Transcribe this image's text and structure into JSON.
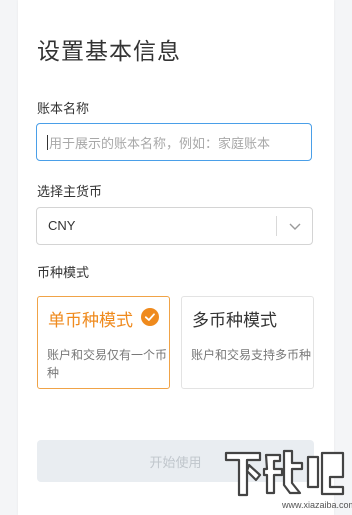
{
  "page": {
    "title": "设置基本信息"
  },
  "account_name": {
    "label": "账本名称",
    "placeholder": "用于展示的账本名称，例如：家庭账本"
  },
  "currency": {
    "label": "选择主货币",
    "selected": "CNY"
  },
  "currency_mode": {
    "label": "币种模式",
    "options": [
      {
        "title": "单币种模式",
        "description": "账户和交易仅有一个币种",
        "selected": true
      },
      {
        "title": "多币种模式",
        "description": "账户和交易支持多币种",
        "selected": false
      }
    ]
  },
  "actions": {
    "start_label": "开始使用"
  },
  "watermark": {
    "logo_text": "下载吧",
    "url_text": "www.xiazaiba.com"
  },
  "colors": {
    "accent_orange": "#ef8a1d",
    "focus_blue": "#4a9fe8",
    "disabled_bg": "#e9edf1"
  },
  "icons": {
    "select_arrow": "chevron-down-icon",
    "selected_mark": "check-circle-icon"
  }
}
